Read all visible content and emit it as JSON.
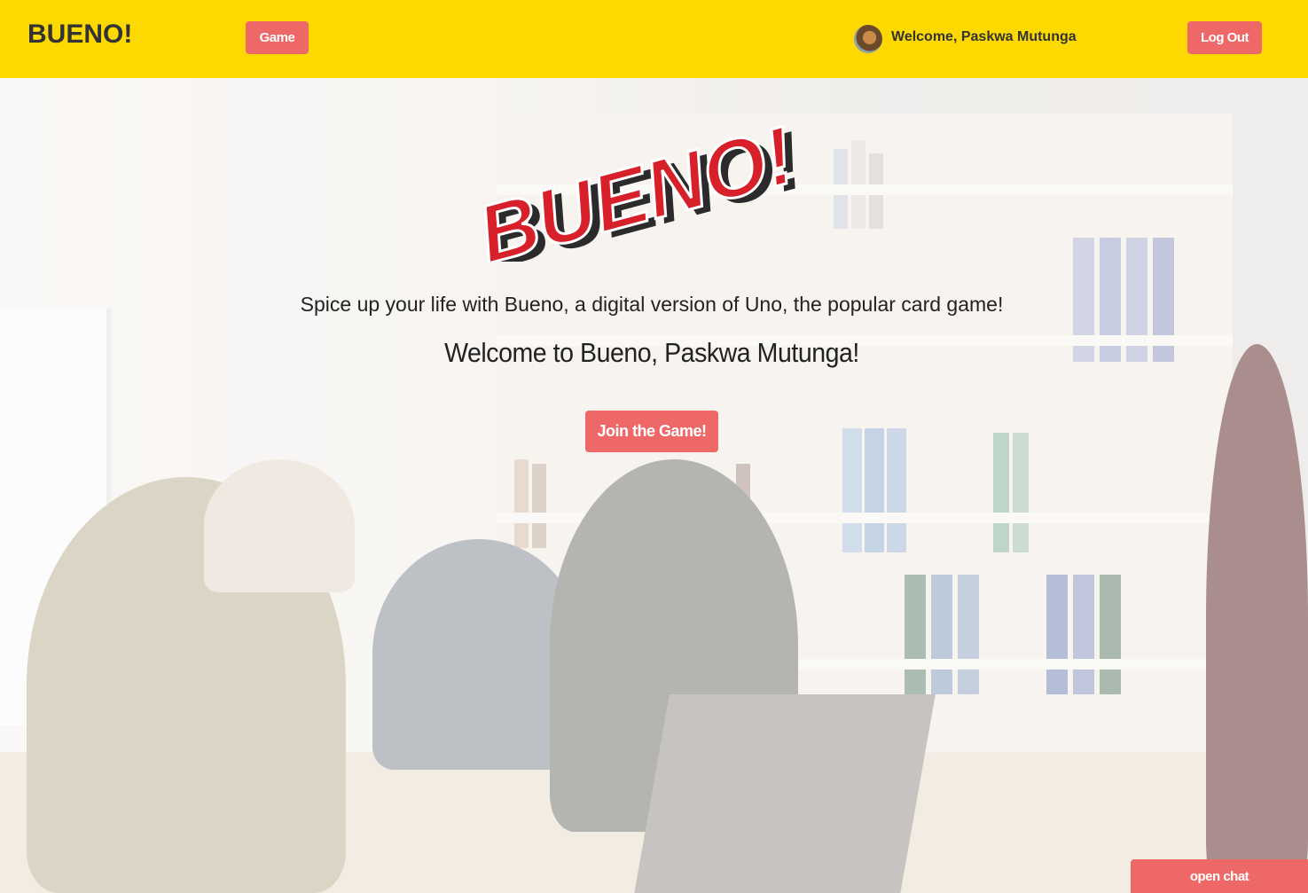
{
  "navbar": {
    "brand": "BUENO!",
    "game_label": "Game",
    "welcome_text": "Welcome, Paskwa Mutunga",
    "logout_label": "Log Out"
  },
  "hero": {
    "logo_text": "BUENO!",
    "tagline": "Spice up your life with Bueno, a digital version of Uno, the popular card game!",
    "welcome": "Welcome to Bueno, Paskwa Mutunga!",
    "join_label": "Join the Game!"
  },
  "chat": {
    "open_label": "open chat"
  },
  "colors": {
    "navbar": "#fdd901",
    "button": "#ee6868",
    "logo_red": "#d8202a"
  }
}
